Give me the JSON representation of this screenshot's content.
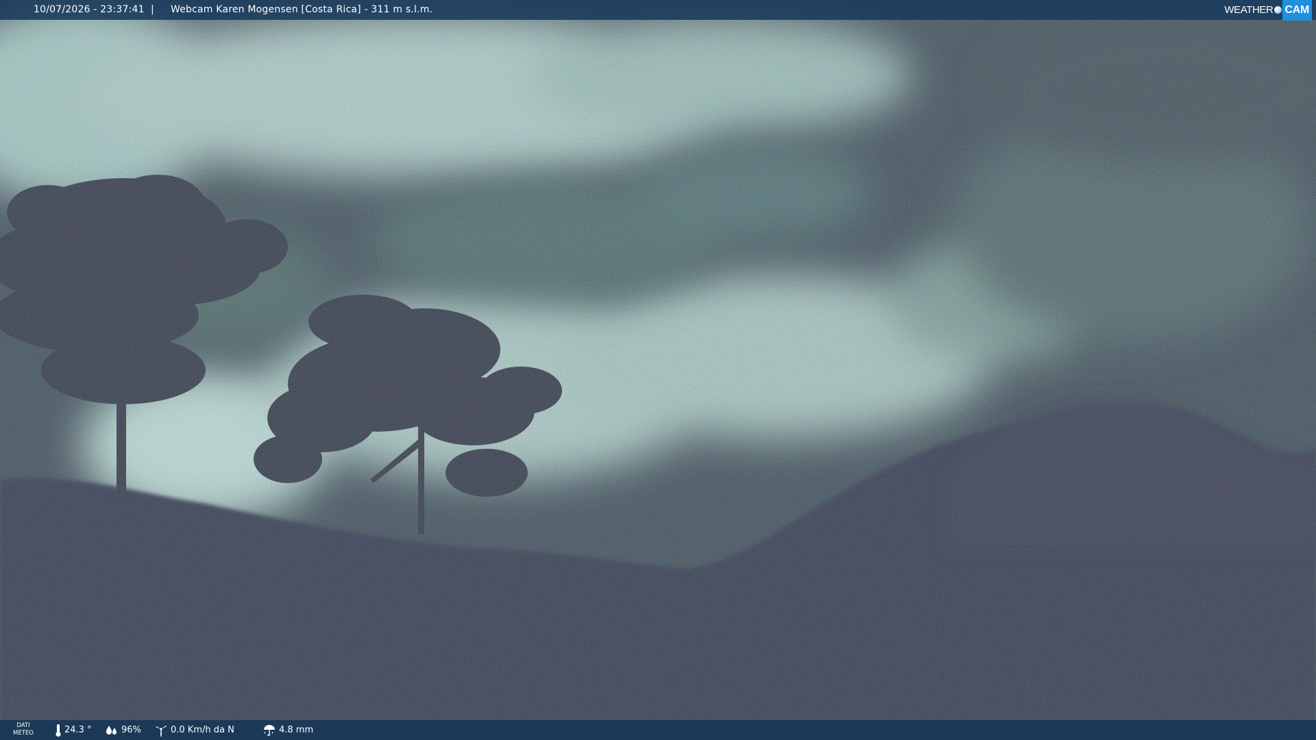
{
  "header": {
    "timestamp": "10/07/2026 - 23:37:41",
    "separator": "|",
    "camera_title": "Webcam Karen Mogensen [Costa Rica] - 311 m s.l.m."
  },
  "logo": {
    "text_weather": "WEATHER",
    "text_cam": "CAM",
    "brand_color": "#1f8fe0"
  },
  "scene": {
    "sky_color": "#a7c9c6",
    "sky_shadow_color": "#3d6566",
    "vegetation_color": "#1c2438",
    "noise": "heavy night-time sensor noise"
  },
  "footer": {
    "label_line1": "DATI",
    "label_line2": "METEO",
    "temperature": "24.3 °",
    "humidity": "96%",
    "wind": "0.0 Km/h da N",
    "rain": "4.8 mm",
    "icons": {
      "temperature": "thermometer-icon",
      "humidity": "humidity-drops-icon",
      "wind": "wind-turbine-icon",
      "rain": "rain-umbrella-icon"
    }
  }
}
